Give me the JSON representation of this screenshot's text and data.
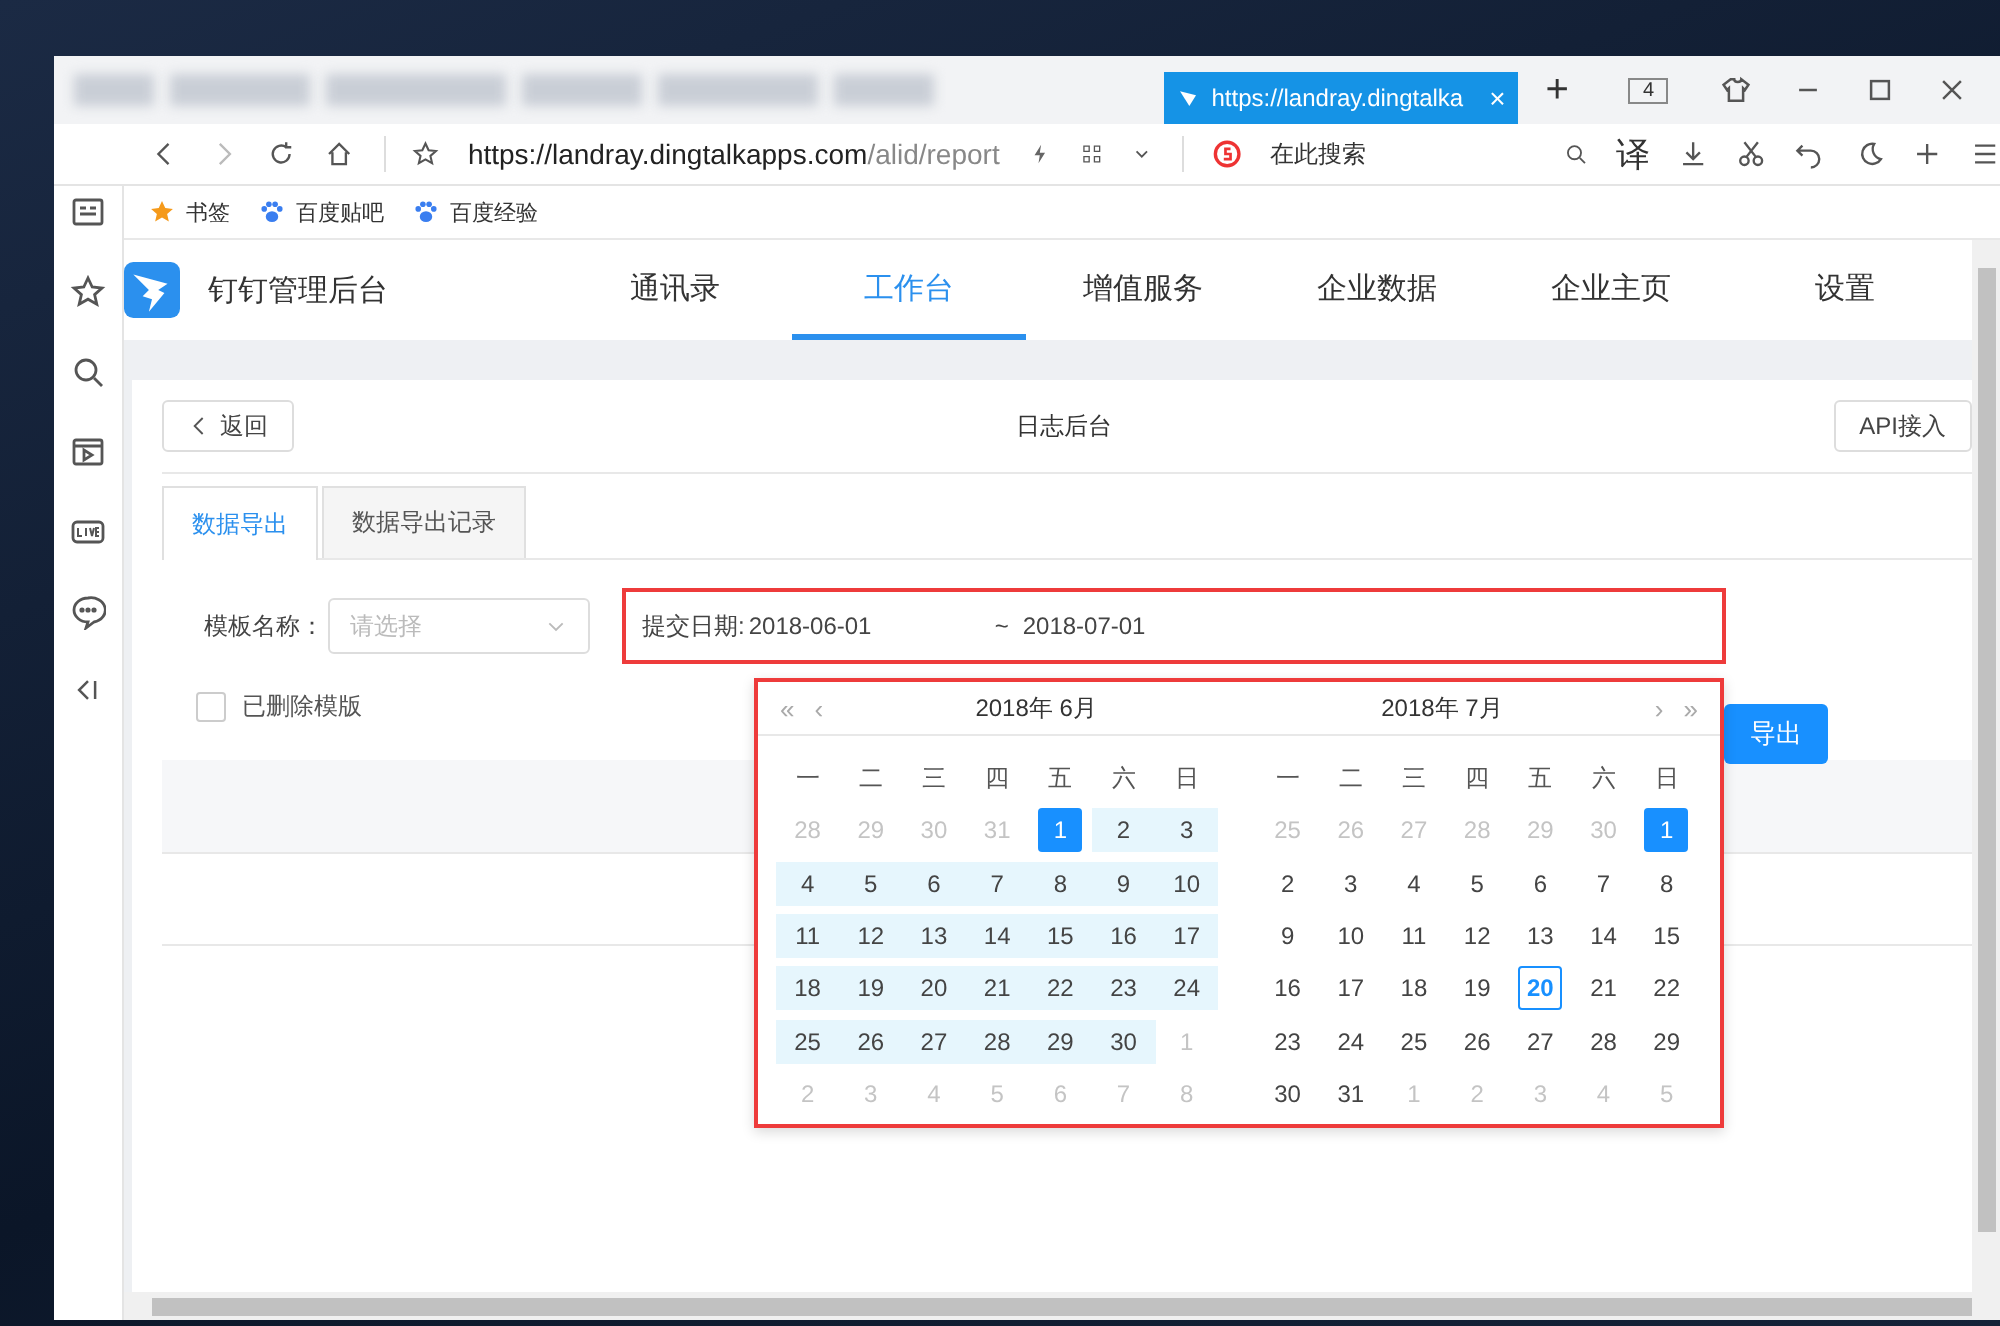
{
  "browser": {
    "active_tab": {
      "title": "https://landray.dingtalka",
      "close": "×"
    },
    "new_tab": "+",
    "tab_count": "4",
    "url": {
      "host": "https://landray.dingtalkapps.com",
      "path": "/alid/report"
    },
    "search_placeholder": "在此搜索",
    "translate": "译",
    "bookmarks": [
      {
        "label": "书签",
        "kind": "favorites"
      },
      {
        "label": "百度贴吧",
        "kind": "site"
      },
      {
        "label": "百度经验",
        "kind": "site"
      }
    ]
  },
  "app": {
    "title": "钉钉管理后台",
    "nav": [
      {
        "label": "通讯录",
        "selected": false
      },
      {
        "label": "工作台",
        "selected": true
      },
      {
        "label": "增值服务",
        "selected": false
      },
      {
        "label": "企业数据",
        "selected": false
      },
      {
        "label": "企业主页",
        "selected": false
      },
      {
        "label": "设置",
        "selected": false
      }
    ]
  },
  "page": {
    "back": "返回",
    "title": "日志后台",
    "api_button": "API接入",
    "tabs": [
      {
        "label": "数据导出",
        "selected": true
      },
      {
        "label": "数据导出记录",
        "selected": false
      }
    ],
    "template": {
      "label": "模板名称：",
      "placeholder": "请选择"
    },
    "date": {
      "label": "提交日期:",
      "start": "2018-06-01",
      "separator": "~",
      "end": "2018-07-01"
    },
    "deleted_checkbox": {
      "label": "已删除模版",
      "checked": false
    },
    "export_button": "导出"
  },
  "calendar": {
    "nav": {
      "prev_year": "«",
      "prev_month": "‹",
      "next_month": "›",
      "next_year": "»"
    },
    "months": [
      {
        "title": "2018年 6月",
        "weekdays": [
          "一",
          "二",
          "三",
          "四",
          "五",
          "六",
          "日"
        ],
        "weeks": [
          [
            {
              "d": "28",
              "kind": "muted"
            },
            {
              "d": "29",
              "kind": "muted"
            },
            {
              "d": "30",
              "kind": "muted"
            },
            {
              "d": "31",
              "kind": "muted"
            },
            {
              "d": "1",
              "kind": "selected"
            },
            {
              "d": "2",
              "kind": "range"
            },
            {
              "d": "3",
              "kind": "range"
            }
          ],
          [
            {
              "d": "4",
              "kind": "range"
            },
            {
              "d": "5",
              "kind": "range"
            },
            {
              "d": "6",
              "kind": "range"
            },
            {
              "d": "7",
              "kind": "range"
            },
            {
              "d": "8",
              "kind": "range"
            },
            {
              "d": "9",
              "kind": "range"
            },
            {
              "d": "10",
              "kind": "range"
            }
          ],
          [
            {
              "d": "11",
              "kind": "range"
            },
            {
              "d": "12",
              "kind": "range"
            },
            {
              "d": "13",
              "kind": "range"
            },
            {
              "d": "14",
              "kind": "range"
            },
            {
              "d": "15",
              "kind": "range"
            },
            {
              "d": "16",
              "kind": "range"
            },
            {
              "d": "17",
              "kind": "range"
            }
          ],
          [
            {
              "d": "18",
              "kind": "range"
            },
            {
              "d": "19",
              "kind": "range"
            },
            {
              "d": "20",
              "kind": "range"
            },
            {
              "d": "21",
              "kind": "range"
            },
            {
              "d": "22",
              "kind": "range"
            },
            {
              "d": "23",
              "kind": "range"
            },
            {
              "d": "24",
              "kind": "range"
            }
          ],
          [
            {
              "d": "25",
              "kind": "range"
            },
            {
              "d": "26",
              "kind": "range"
            },
            {
              "d": "27",
              "kind": "range"
            },
            {
              "d": "28",
              "kind": "range"
            },
            {
              "d": "29",
              "kind": "range"
            },
            {
              "d": "30",
              "kind": "range"
            },
            {
              "d": "1",
              "kind": "muted"
            }
          ],
          [
            {
              "d": "2",
              "kind": "muted"
            },
            {
              "d": "3",
              "kind": "muted"
            },
            {
              "d": "4",
              "kind": "muted"
            },
            {
              "d": "5",
              "kind": "muted"
            },
            {
              "d": "6",
              "kind": "muted"
            },
            {
              "d": "7",
              "kind": "muted"
            },
            {
              "d": "8",
              "kind": "muted"
            }
          ]
        ]
      },
      {
        "title": "2018年 7月",
        "weekdays": [
          "一",
          "二",
          "三",
          "四",
          "五",
          "六",
          "日"
        ],
        "weeks": [
          [
            {
              "d": "25",
              "kind": "muted"
            },
            {
              "d": "26",
              "kind": "muted"
            },
            {
              "d": "27",
              "kind": "muted"
            },
            {
              "d": "28",
              "kind": "muted"
            },
            {
              "d": "29",
              "kind": "muted"
            },
            {
              "d": "30",
              "kind": "muted"
            },
            {
              "d": "1",
              "kind": "selected"
            }
          ],
          [
            {
              "d": "2",
              "kind": "plain"
            },
            {
              "d": "3",
              "kind": "plain"
            },
            {
              "d": "4",
              "kind": "plain"
            },
            {
              "d": "5",
              "kind": "plain"
            },
            {
              "d": "6",
              "kind": "plain"
            },
            {
              "d": "7",
              "kind": "plain"
            },
            {
              "d": "8",
              "kind": "plain"
            }
          ],
          [
            {
              "d": "9",
              "kind": "plain"
            },
            {
              "d": "10",
              "kind": "plain"
            },
            {
              "d": "11",
              "kind": "plain"
            },
            {
              "d": "12",
              "kind": "plain"
            },
            {
              "d": "13",
              "kind": "plain"
            },
            {
              "d": "14",
              "kind": "plain"
            },
            {
              "d": "15",
              "kind": "plain"
            }
          ],
          [
            {
              "d": "16",
              "kind": "plain"
            },
            {
              "d": "17",
              "kind": "plain"
            },
            {
              "d": "18",
              "kind": "plain"
            },
            {
              "d": "19",
              "kind": "plain"
            },
            {
              "d": "20",
              "kind": "today"
            },
            {
              "d": "21",
              "kind": "plain"
            },
            {
              "d": "22",
              "kind": "plain"
            }
          ],
          [
            {
              "d": "23",
              "kind": "plain"
            },
            {
              "d": "24",
              "kind": "plain"
            },
            {
              "d": "25",
              "kind": "plain"
            },
            {
              "d": "26",
              "kind": "plain"
            },
            {
              "d": "27",
              "kind": "plain"
            },
            {
              "d": "28",
              "kind": "plain"
            },
            {
              "d": "29",
              "kind": "plain"
            }
          ],
          [
            {
              "d": "30",
              "kind": "plain"
            },
            {
              "d": "31",
              "kind": "plain"
            },
            {
              "d": "1",
              "kind": "muted"
            },
            {
              "d": "2",
              "kind": "muted"
            },
            {
              "d": "3",
              "kind": "muted"
            },
            {
              "d": "4",
              "kind": "muted"
            },
            {
              "d": "5",
              "kind": "muted"
            }
          ]
        ]
      }
    ]
  }
}
